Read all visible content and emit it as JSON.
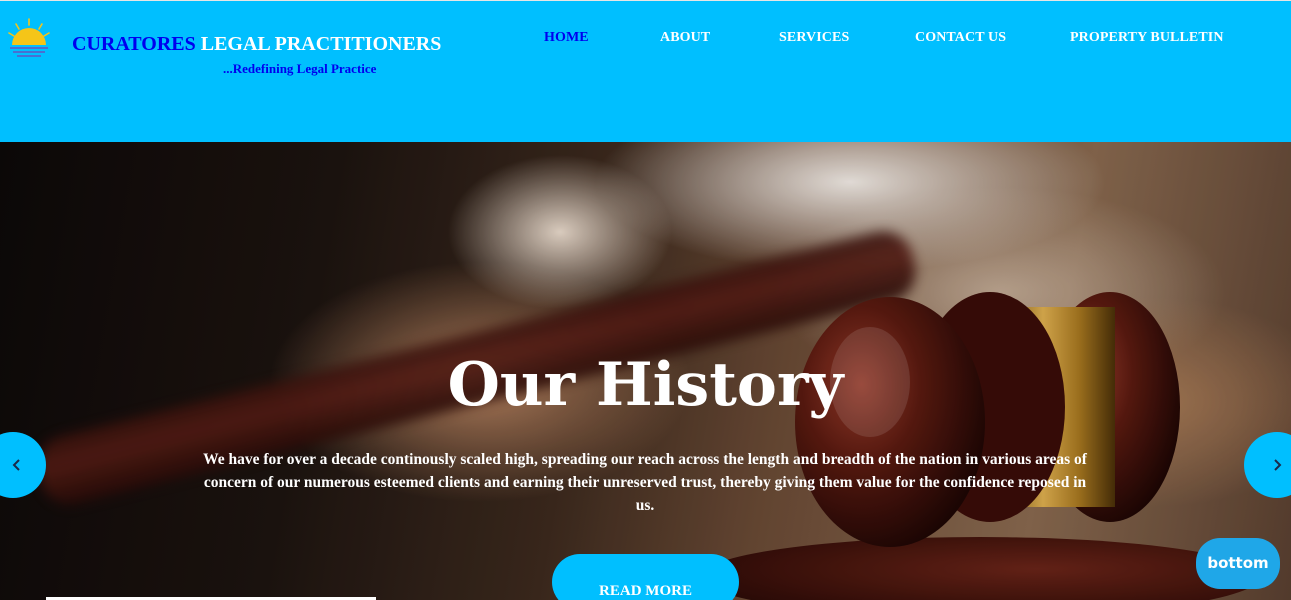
{
  "brand": {
    "name_part1": "CURATORES",
    "name_part2": " LEGAL PRACTITIONERS",
    "tagline": "...Redefining Legal Practice",
    "logo_icon": "sunrise-icon"
  },
  "nav": {
    "items": [
      {
        "label": "HOME",
        "active": true
      },
      {
        "label": "ABOUT",
        "active": false
      },
      {
        "label": "SERVICES",
        "active": false
      },
      {
        "label": "CONTACT US",
        "active": false
      },
      {
        "label": "PROPERTY BULLETIN",
        "active": false
      }
    ]
  },
  "hero": {
    "title": "Our History",
    "text": "We have for over a decade continously scaled high, spreading our reach across the length and breadth of the nation in various areas of concern of our numerous esteemed clients and earning their unreserved trust, thereby giving them value for the confidence reposed in us.",
    "button_label": "READ MORE",
    "prev_icon": "chevron-left-icon",
    "next_icon": "chevron-right-icon"
  },
  "floating": {
    "bottom_label": "bottom"
  },
  "colors": {
    "header_bg": "#00bfff",
    "brand_blue": "#0000ee",
    "accent": "#00bfff",
    "bottom_button": "#1fa7e8"
  }
}
